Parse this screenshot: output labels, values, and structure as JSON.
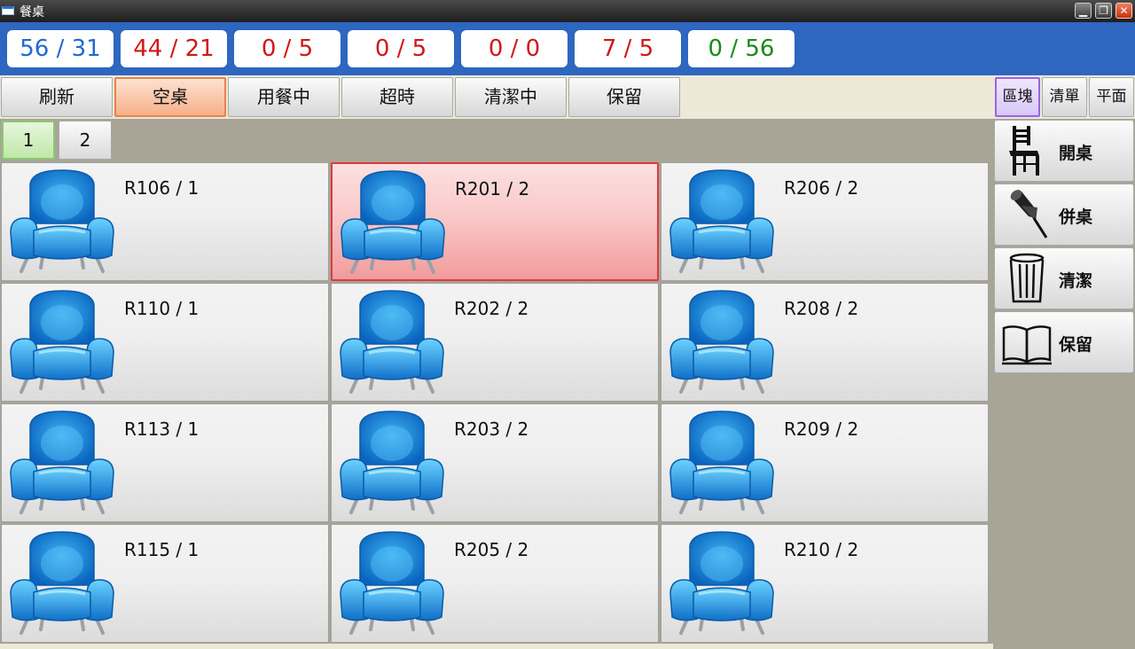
{
  "window": {
    "title": "餐桌"
  },
  "counters": [
    {
      "text": "56 / 31",
      "color": "#1f6ad0"
    },
    {
      "text": "44 / 21",
      "color": "#d01818"
    },
    {
      "text": "0 / 5",
      "color": "#d01818"
    },
    {
      "text": "0 / 5",
      "color": "#d01818"
    },
    {
      "text": "0 / 0",
      "color": "#d01818"
    },
    {
      "text": "7 / 5",
      "color": "#d01818"
    },
    {
      "text": "0 / 56",
      "color": "#1a8a1a"
    }
  ],
  "filters": [
    {
      "label": "刷新",
      "active": false
    },
    {
      "label": "空桌",
      "active": true
    },
    {
      "label": "用餐中",
      "active": false
    },
    {
      "label": "超時",
      "active": false
    },
    {
      "label": "清潔中",
      "active": false
    },
    {
      "label": "保留",
      "active": false
    }
  ],
  "pages": [
    {
      "label": "1",
      "active": true
    },
    {
      "label": "2",
      "active": false
    }
  ],
  "view_tabs": [
    {
      "label": "區塊",
      "active": true
    },
    {
      "label": "清單",
      "active": false
    },
    {
      "label": "平面",
      "active": false
    }
  ],
  "actions": [
    {
      "label": "開桌",
      "icon": "chair-icon"
    },
    {
      "label": "併桌",
      "icon": "pushpin-icon"
    },
    {
      "label": "清潔",
      "icon": "trash-can-icon"
    },
    {
      "label": "保留",
      "icon": "open-book-icon"
    }
  ],
  "tables": [
    {
      "label": "R106 / 1",
      "selected": false
    },
    {
      "label": "R201 / 2",
      "selected": true
    },
    {
      "label": "R206 / 2",
      "selected": false
    },
    {
      "label": "R110 / 1",
      "selected": false
    },
    {
      "label": "R202 / 2",
      "selected": false
    },
    {
      "label": "R208 / 2",
      "selected": false
    },
    {
      "label": "R113 / 1",
      "selected": false
    },
    {
      "label": "R203 / 2",
      "selected": false
    },
    {
      "label": "R209 / 2",
      "selected": false
    },
    {
      "label": "R115 / 1",
      "selected": false
    },
    {
      "label": "R205 / 2",
      "selected": false
    },
    {
      "label": "R210 / 2",
      "selected": false
    }
  ],
  "colors": {
    "accent_blue": "#2e66c0",
    "selected_red": "#e0393e",
    "active_orange": "#e8824a",
    "active_purple": "#9a64e4",
    "active_green": "#8cc870"
  }
}
